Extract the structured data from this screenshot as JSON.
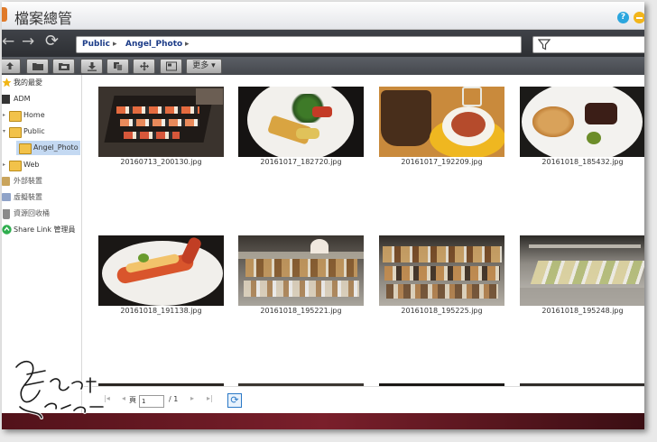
{
  "window": {
    "title": "檔案總管",
    "help_glyph": "?"
  },
  "nav": {
    "back_glyph": "←",
    "forward_glyph": "→",
    "refresh_glyph": "⟳",
    "path": [
      "Public",
      "Angel_Photo"
    ],
    "sep_glyph": "▸"
  },
  "toolbar": {
    "more_label": "更多 ▾"
  },
  "sidebar": {
    "items": [
      {
        "label": "我的最愛",
        "icon": "star-icon"
      },
      {
        "label": "ADM",
        "icon": "adm-icon"
      },
      {
        "label": "Home",
        "icon": "folder-icon"
      },
      {
        "label": "Public",
        "icon": "folder-icon"
      },
      {
        "label": "Angel_Photo",
        "icon": "folder-icon"
      },
      {
        "label": "Web",
        "icon": "folder-icon"
      },
      {
        "label": "外部裝置",
        "icon": "external-device-icon"
      },
      {
        "label": "虛擬裝置",
        "icon": "virtual-device-icon"
      },
      {
        "label": "資源回收桶",
        "icon": "recycle-bin-icon"
      },
      {
        "label": "Share Link 管理員",
        "icon": "share-link-icon"
      }
    ]
  },
  "files": [
    {
      "name": "20160713_200130.jpg"
    },
    {
      "name": "20161017_182720.jpg"
    },
    {
      "name": "20161017_192209.jpg"
    },
    {
      "name": "20161018_185432.jpg"
    },
    {
      "name": "20161018_191138.jpg"
    },
    {
      "name": "20161018_195221.jpg"
    },
    {
      "name": "20161018_195225.jpg"
    },
    {
      "name": "20161018_195248.jpg"
    }
  ],
  "pager": {
    "first_glyph": "|◂",
    "prev_glyph": "◂",
    "page_label": "頁",
    "page_value": "1",
    "total": "/ 1",
    "next_glyph": "▸",
    "last_glyph": "▸|"
  },
  "colors": {
    "accent": "#1c3c88",
    "selected": "#c4d9f2",
    "toolbar": "#45484d"
  }
}
